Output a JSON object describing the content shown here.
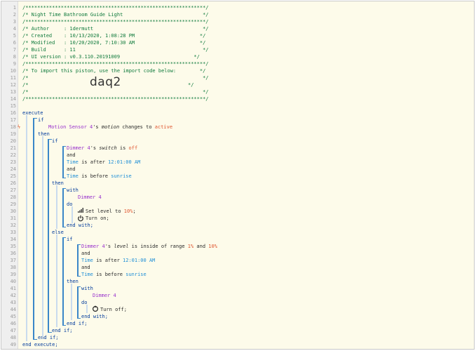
{
  "header_comment": {
    "border": "/*************************************************************/",
    "title": "/* Night Time Bathroom Guide Light                           */",
    "author": "/* Author     : 1dermutt                                     */",
    "created": "/* Created    : 10/13/2020, 1:08:28 PM                      */",
    "modified": "/* Modified   : 10/20/2020, 7:10:30 AM                      */",
    "build": "/* Build      : 11                                           */",
    "ui_version": "/* UI version : v0.3.110.20191009                         */",
    "import_text": "/* To import this piston, use the import code below:        */",
    "blank": "/*                                                           */",
    "import_code": "daq2",
    "import_code_prefix": "/*",
    "import_code_suffix": "*/"
  },
  "piston": {
    "execute": "execute",
    "if": "if",
    "then": "then",
    "else": "else",
    "and": "and",
    "with": "with",
    "do": "do",
    "end_if": "end if;",
    "end_with": "end with;",
    "end_execute": "end execute;",
    "trigger": {
      "device": "Motion Sensor 4",
      "possessive": "'s",
      "attribute": "motion",
      "op": "changes to",
      "value": "active"
    },
    "cond_switch": {
      "device": "Dimmer 4",
      "possessive": "'s",
      "attribute": "switch",
      "op": "is",
      "value": "off"
    },
    "cond_time_after": {
      "var": "Time",
      "op": "is after",
      "value": "12:01:00 AM"
    },
    "cond_time_before": {
      "var": "Time",
      "op": "is before",
      "value": "sunrise"
    },
    "with_device": "Dimmer 4",
    "action_level": "Set level to",
    "action_level_value": "10%",
    "action_level_end": ";",
    "action_on": "Turn on;",
    "cond_range": {
      "device": "Dimmer 4",
      "possessive": "'s",
      "attribute": "level",
      "op": "is inside of range",
      "from": "1%",
      "and": "and",
      "to": "10%"
    },
    "action_off": "Turn off;"
  },
  "line_numbers": [
    "1",
    "2",
    "3",
    "4",
    "5",
    "6",
    "7",
    "8",
    "9",
    "10",
    "11",
    "12",
    "13",
    "14",
    "15",
    "16",
    "17",
    "18",
    "19",
    "20",
    "21",
    "22",
    "23",
    "24",
    "25",
    "26",
    "27",
    "28",
    "29",
    "30",
    "31",
    "32",
    "33",
    "34",
    "35",
    "36",
    "37",
    "38",
    "39",
    "40",
    "41",
    "42",
    "43",
    "44",
    "45",
    "46",
    "47",
    "48",
    "49"
  ],
  "trigger_marker": "ϟ",
  "colors": {
    "comment": "#0f7a3c",
    "keyword": "#003a9b",
    "device": "#9932cc",
    "variable": "#1e8ed6",
    "value": "#e0552f",
    "rail": "#3a86c8",
    "background": "#fdfbea"
  }
}
